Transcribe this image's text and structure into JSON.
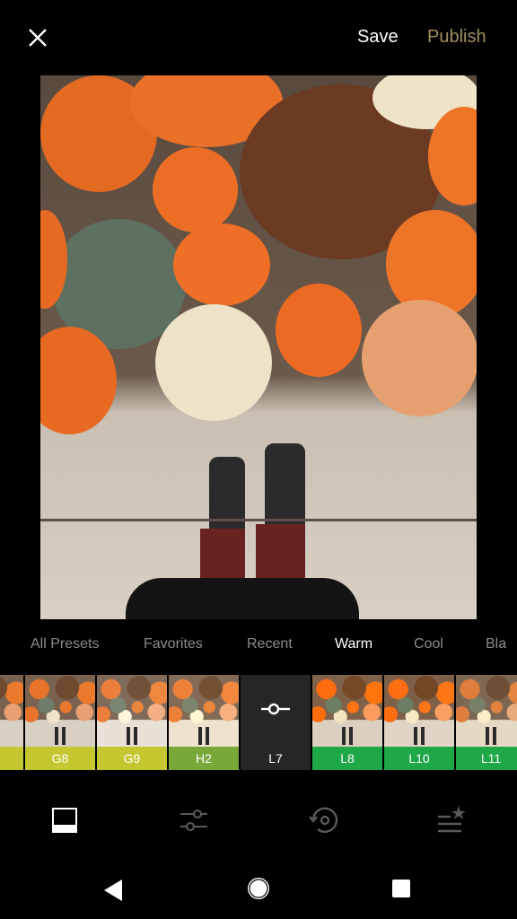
{
  "header": {
    "close_icon": "close-icon",
    "save_label": "Save",
    "publish_label": "Publish",
    "publish_color": "#a38f5e"
  },
  "photo": {
    "description": "Overhead view of pumpkins on a wooden step with boots on pavement"
  },
  "preset_tabs": [
    {
      "label": "All Presets",
      "active": false
    },
    {
      "label": "Favorites",
      "active": false
    },
    {
      "label": "Recent",
      "active": false
    },
    {
      "label": "Warm",
      "active": true
    },
    {
      "label": "Cool",
      "active": false
    },
    {
      "label": "Bla",
      "active": false
    }
  ],
  "presets": [
    {
      "label": "",
      "color": "#c6c631",
      "selected": false
    },
    {
      "label": "G8",
      "color": "#c6c631",
      "selected": false
    },
    {
      "label": "G9",
      "color": "#c6c631",
      "selected": false
    },
    {
      "label": "H2",
      "color": "#79a83a",
      "selected": false
    },
    {
      "label": "L7",
      "color": "#262626",
      "selected": true,
      "icon": "adjust-slider-icon"
    },
    {
      "label": "L8",
      "color": "#1fa847",
      "selected": false
    },
    {
      "label": "L10",
      "color": "#1fa847",
      "selected": false
    },
    {
      "label": "L11",
      "color": "#1fa847",
      "selected": false
    }
  ],
  "bottom_nav": [
    {
      "icon": "presets-icon",
      "active": true
    },
    {
      "icon": "adjust-sliders-icon",
      "active": false
    },
    {
      "icon": "history-icon",
      "active": false
    },
    {
      "icon": "recipes-icon",
      "active": false
    }
  ],
  "system_nav": [
    {
      "icon": "back-icon"
    },
    {
      "icon": "home-icon"
    },
    {
      "icon": "recents-icon"
    }
  ]
}
